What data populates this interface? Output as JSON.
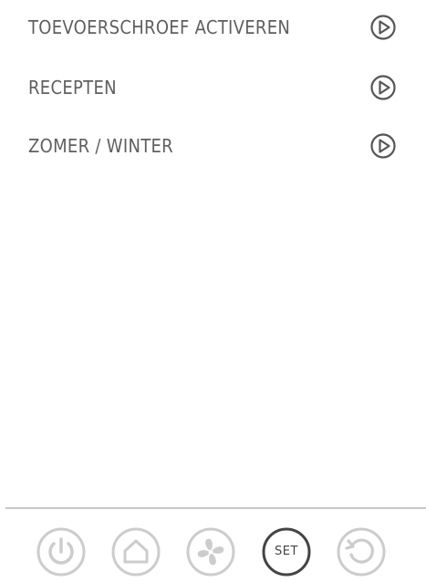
{
  "menu": {
    "items": [
      {
        "label": "TOEVOERSCHROEF ACTIVEREN",
        "icon": "play-circle-icon"
      },
      {
        "label": "RECEPTEN",
        "icon": "play-circle-icon"
      },
      {
        "label": "ZOMER / WINTER",
        "icon": "play-circle-icon"
      }
    ]
  },
  "navbar": {
    "items": [
      {
        "name": "power",
        "icon": "power-icon",
        "active": false
      },
      {
        "name": "home",
        "icon": "home-icon",
        "active": false
      },
      {
        "name": "fan",
        "icon": "fan-icon",
        "active": false
      },
      {
        "name": "set",
        "label": "SET",
        "active": true
      },
      {
        "name": "back",
        "icon": "refresh-icon",
        "active": false
      }
    ]
  },
  "colors": {
    "text": "#5f5f5f",
    "icon_active": "#444444",
    "icon_inactive": "#cccccc",
    "divider": "#c8c8c8"
  }
}
